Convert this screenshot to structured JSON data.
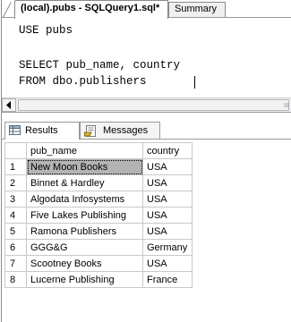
{
  "document_tabs": [
    {
      "label": "(local).pubs - SQLQuery1.sql*",
      "active": true
    },
    {
      "label": "Summary",
      "active": false
    }
  ],
  "editor": {
    "lines": [
      "USE pubs",
      "",
      "SELECT pub_name, country",
      "FROM dbo.publishers"
    ]
  },
  "scrollbar": {
    "left_arrow": "<",
    "grip": "III"
  },
  "results_tabs": [
    {
      "label": "Results",
      "icon": "grid-icon",
      "active": true
    },
    {
      "label": "Messages",
      "icon": "messages-icon",
      "active": false
    }
  ],
  "grid": {
    "columns": [
      "pub_name",
      "country"
    ],
    "rows": [
      {
        "num": "1",
        "pub_name": "New Moon Books",
        "country": "USA"
      },
      {
        "num": "2",
        "pub_name": "Binnet & Hardley",
        "country": "USA"
      },
      {
        "num": "3",
        "pub_name": "Algodata Infosystems",
        "country": "USA"
      },
      {
        "num": "4",
        "pub_name": "Five Lakes Publishing",
        "country": "USA"
      },
      {
        "num": "5",
        "pub_name": "Ramona Publishers",
        "country": "USA"
      },
      {
        "num": "6",
        "pub_name": "GGG&G",
        "country": "Germany"
      },
      {
        "num": "7",
        "pub_name": "Scootney Books",
        "country": "USA"
      },
      {
        "num": "8",
        "pub_name": "Lucerne Publishing",
        "country": "France"
      }
    ],
    "selected_cell": "1.pub_name"
  },
  "colors": {
    "selection": "#b4b4b4",
    "border": "#9a9a9a",
    "grid_line": "#c8c8c8"
  }
}
